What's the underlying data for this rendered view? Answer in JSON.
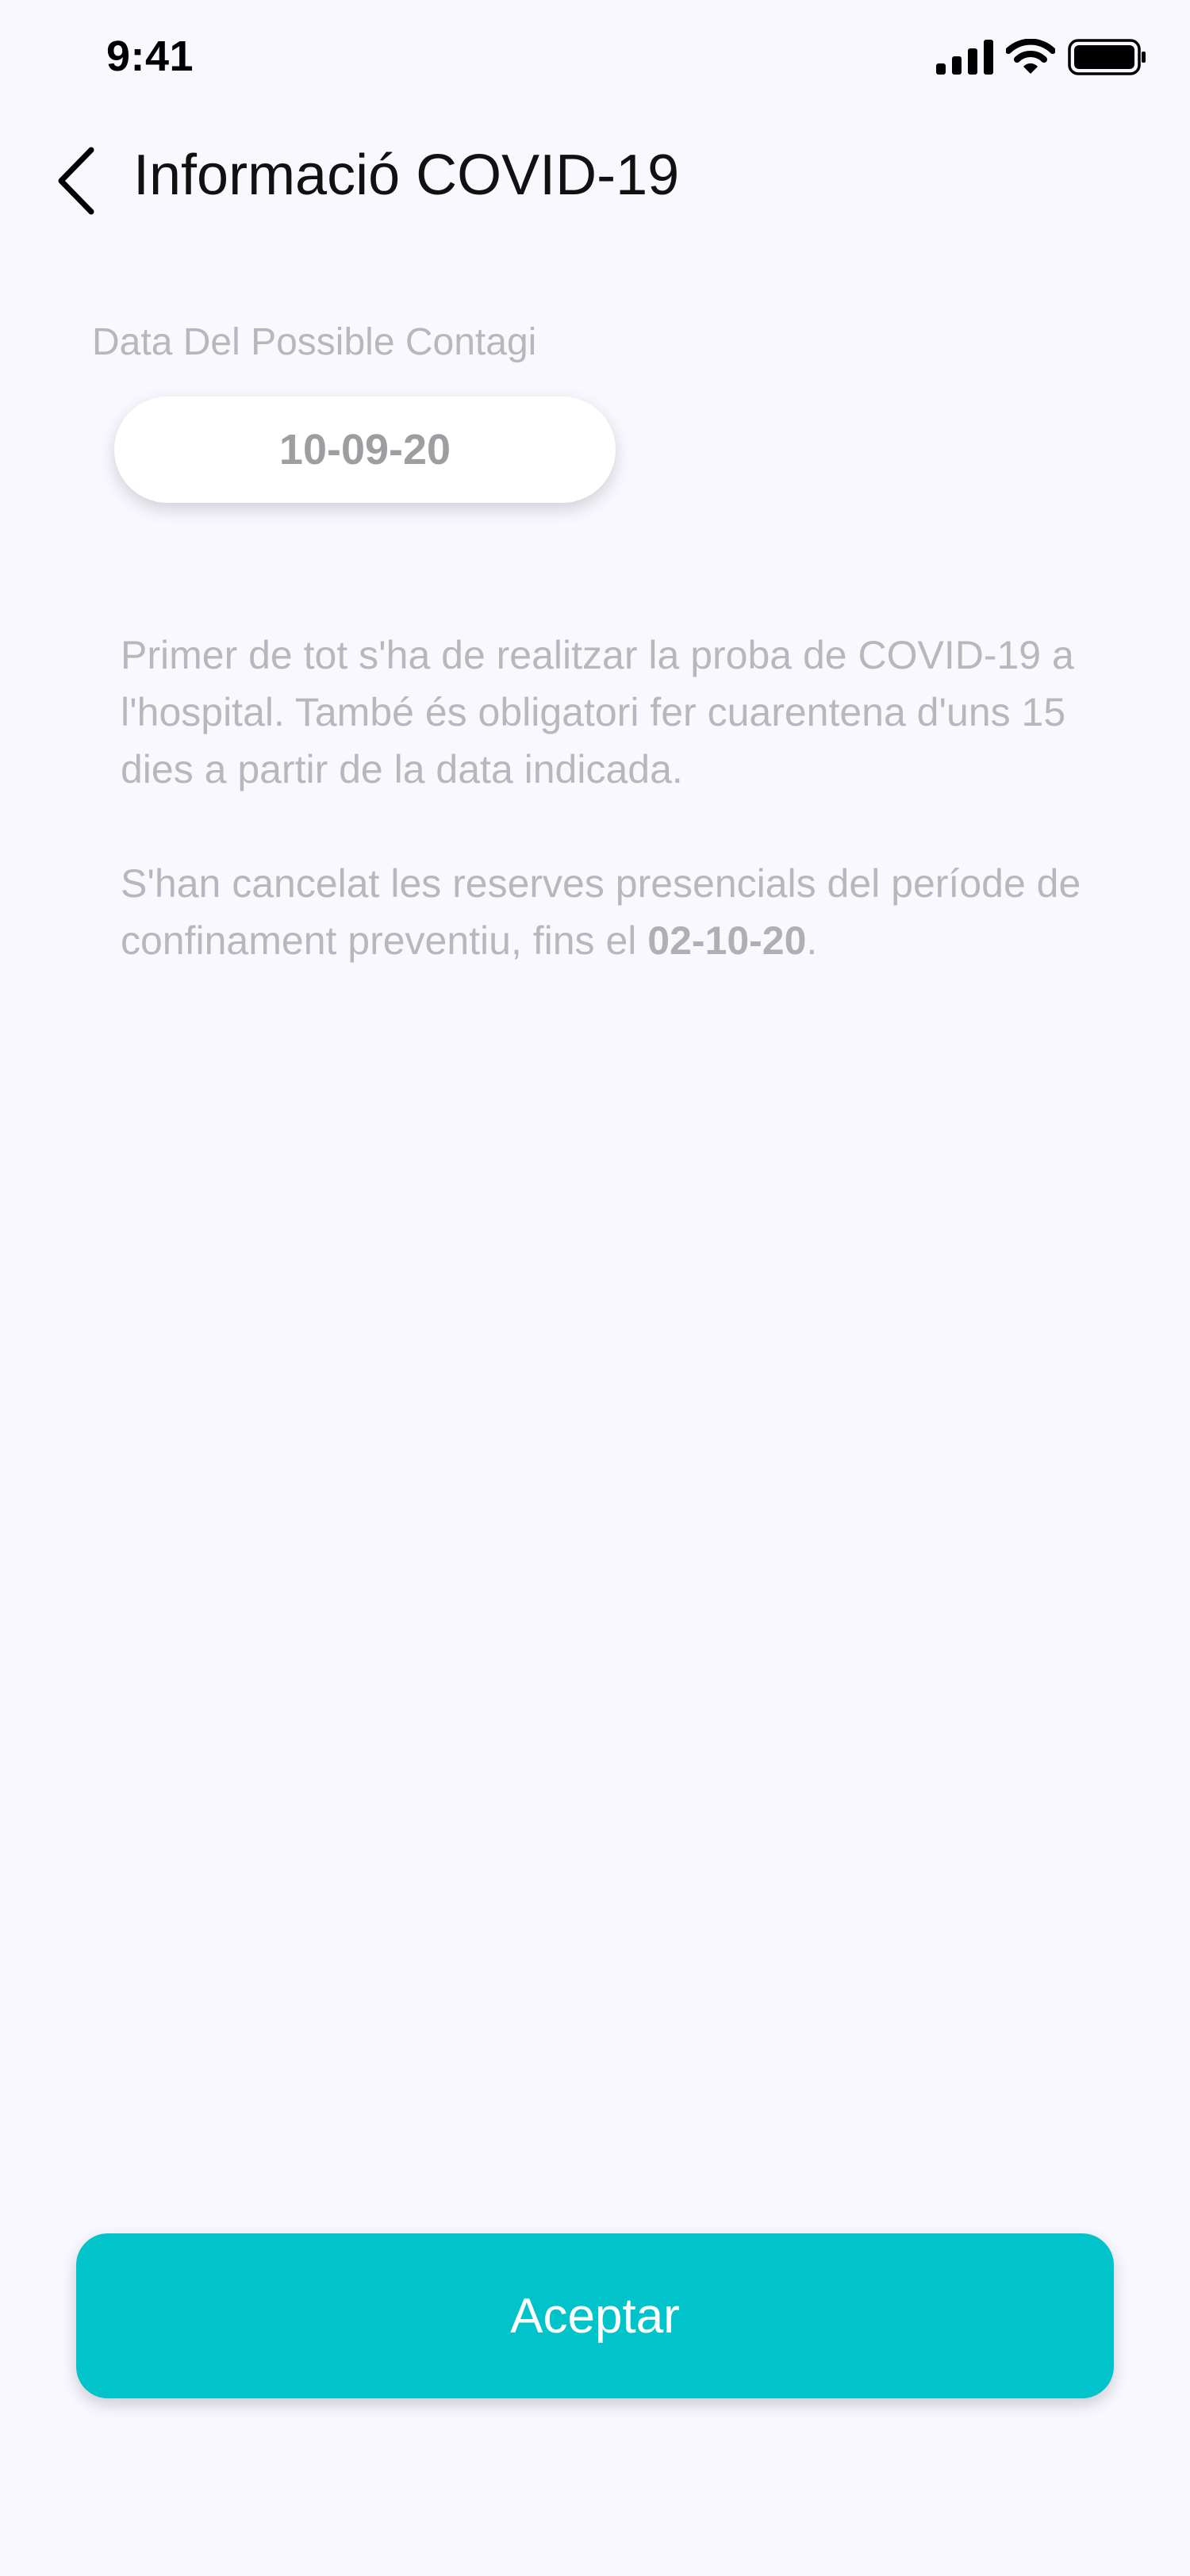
{
  "status_bar": {
    "time": "9:41"
  },
  "header": {
    "title": "Informació COVID-19",
    "back_icon": "chevron-left-icon"
  },
  "date_field": {
    "label": "Data Del Possible Contagi",
    "value": "10-09-20"
  },
  "info": {
    "paragraph1": "Primer de tot s'ha de realitzar la proba de COVID-19 a l'hospital. També és obligatori fer cuarentena d'uns 15 dies a partir de la data indicada.",
    "paragraph2_prefix": "S'han cancelat les reserves presencials del període de confinament preventiu, fins el ",
    "paragraph2_date": "02-10-20",
    "paragraph2_suffix": "."
  },
  "accept_button": {
    "label": "Aceptar"
  },
  "colors": {
    "background": "#f8f8fe",
    "accent": "#00c4c9",
    "muted_text": "#b8b8bc"
  }
}
